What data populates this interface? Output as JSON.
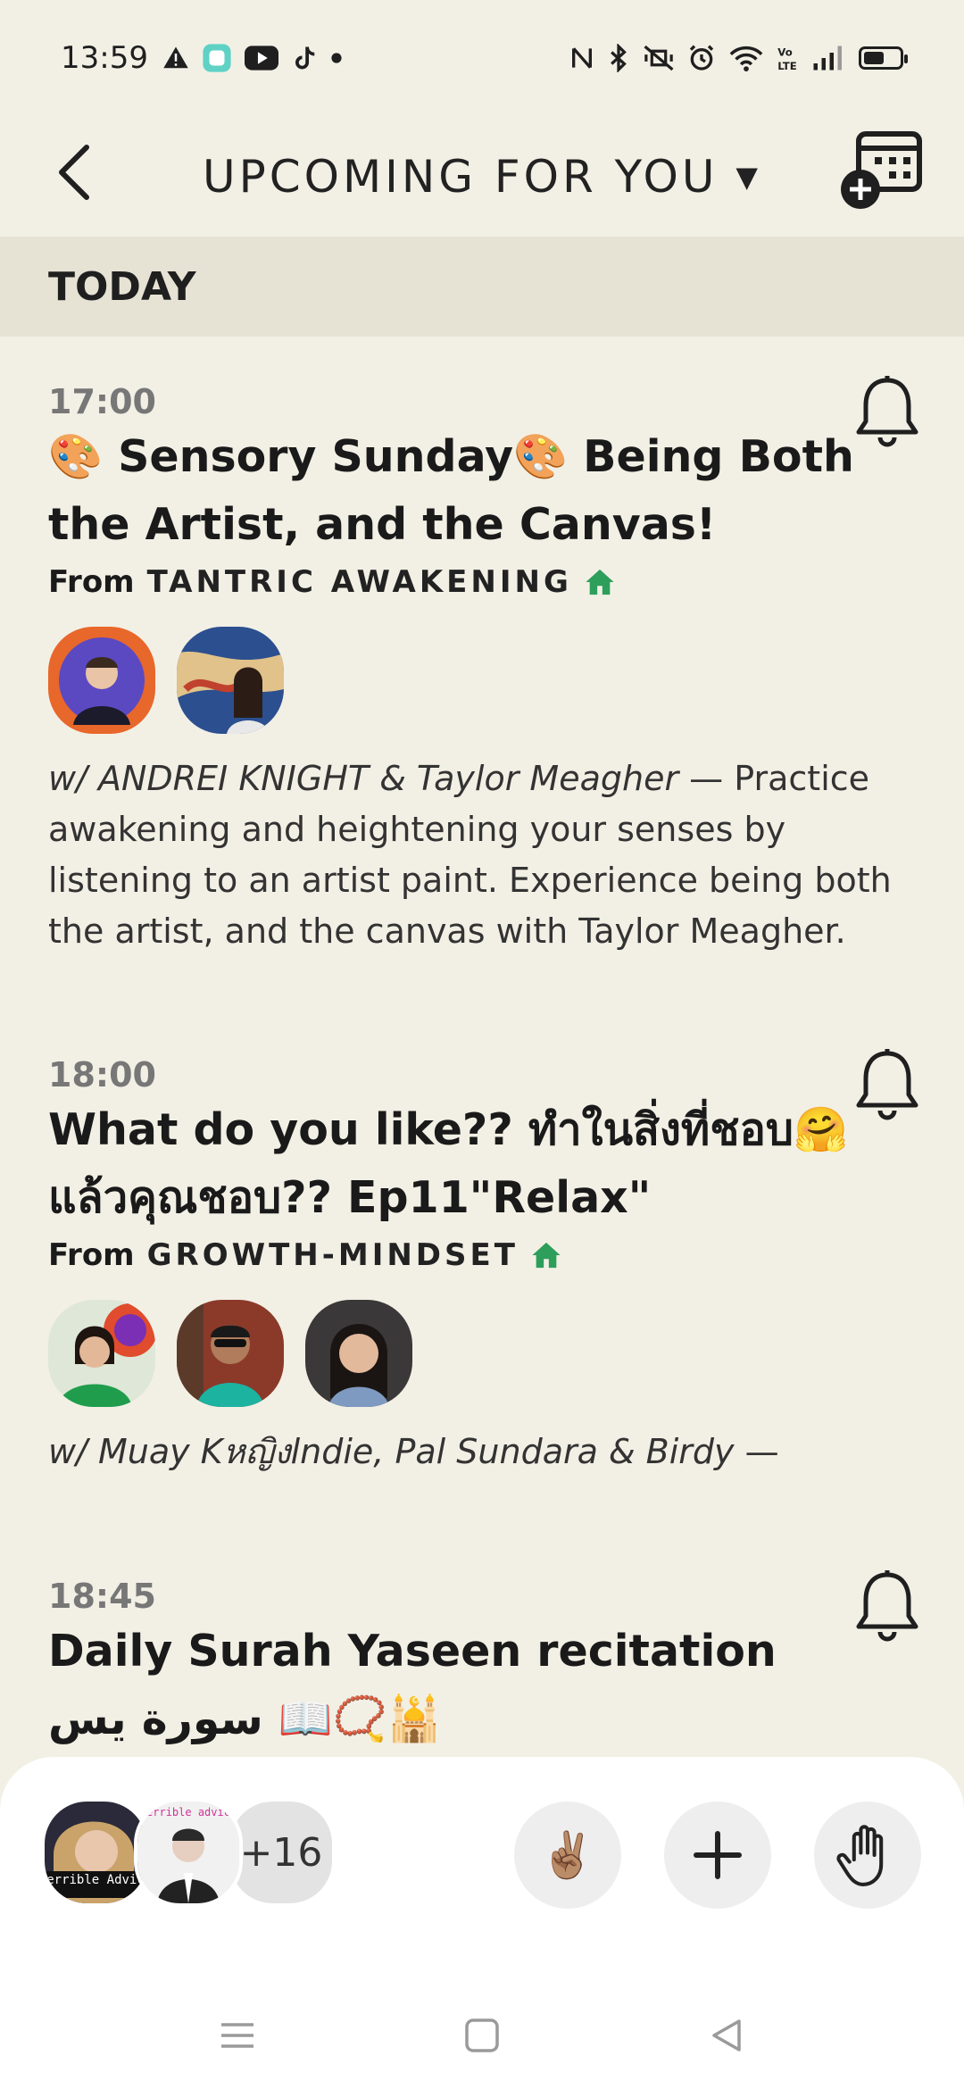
{
  "status_bar": {
    "time": "13:59",
    "left_icons": [
      "alert-icon",
      "app-icon",
      "youtube-icon",
      "tiktok-icon",
      "dot-icon"
    ],
    "right_icons": [
      "nfc-icon",
      "bluetooth-icon",
      "vibrate-icon",
      "alarm-icon",
      "wifi-icon",
      "volte-icon",
      "signal-icon",
      "battery-icon"
    ]
  },
  "header": {
    "title": "UPCOMING FOR YOU",
    "dropdown_indicator": "▼"
  },
  "section": {
    "label": "TODAY"
  },
  "events": [
    {
      "time": "17:00",
      "title": "🎨 Sensory Sunday🎨 Being Both the Artist, and the Canvas!",
      "from_label": "From",
      "club": "TANTRIC AWAKENING",
      "hosts": "w/ ANDREI KNIGHT & Taylor Meagher",
      "description": " — Practice awakening and heightening your senses by listening to an artist paint.  Experience being both the artist, and the canvas with Taylor Meagher."
    },
    {
      "time": "18:00",
      "title": "What do you like?? ทำในสิ่งที่ชอบ🤗แล้วคุณชอบ?? Ep11\"Relax\"",
      "from_label": "From",
      "club": "GROWTH-MINDSET",
      "hosts": "w/ Muay Kหญิงlndie, Pal Sundara & Birdy",
      "description": " —"
    },
    {
      "time": "18:45",
      "title": "Daily Surah Yaseen recitation سورة يس 📖📿🕌"
    }
  ],
  "bottom_bar": {
    "more_count": "+16",
    "mini_avatar_2_text": "terrible advice",
    "mini_avatar_1_text": "Terrible Advice",
    "peace_emoji": "✌🏽"
  },
  "colors": {
    "background": "#f2f0e5",
    "section_bg": "#e6e3d5",
    "house_green": "#2e9e5b"
  }
}
